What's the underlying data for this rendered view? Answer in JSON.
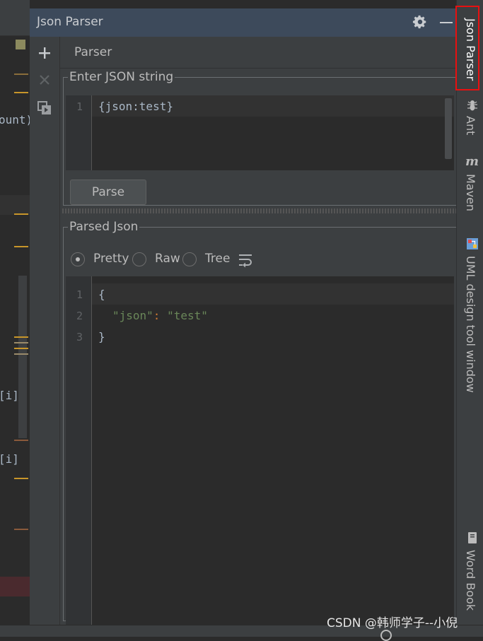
{
  "window": {
    "title": "Json Parser",
    "settings_icon": "gear-icon",
    "minimize_icon": "minimize-icon"
  },
  "toolbar": {
    "add_icon": "plus-icon",
    "close_icon": "close-icon",
    "new_window_icon": "new-window-icon"
  },
  "tab": {
    "label": "Parser"
  },
  "input_section": {
    "legend": "Enter JSON string",
    "line_numbers": [
      "1"
    ],
    "lines": [
      "{json:test}"
    ],
    "parse_button": "Parse"
  },
  "output_section": {
    "legend": "Parsed Json",
    "view_modes": [
      {
        "label": "Pretty",
        "selected": true
      },
      {
        "label": "Raw",
        "selected": false
      },
      {
        "label": "Tree",
        "selected": false
      }
    ],
    "wrap_icon": "soft-wrap-icon",
    "line_numbers": [
      "1",
      "2",
      "3"
    ],
    "lines": {
      "l1": "{",
      "l2_key": "\"json\"",
      "l2_colon": ": ",
      "l2_value": "\"test\"",
      "l3": "}"
    }
  },
  "right_stripe": {
    "items": [
      {
        "label": "Json Parser",
        "icon": "",
        "active": true
      },
      {
        "label": "Ant",
        "icon": "ant-icon",
        "active": false
      },
      {
        "label": "Maven",
        "icon": "maven-icon",
        "active": false
      },
      {
        "label": "UML design tool window",
        "icon": "uml-icon",
        "active": false
      },
      {
        "label": "Word Book",
        "icon": "book-icon",
        "active": false
      }
    ]
  },
  "editor_fragments": {
    "f1": "ount)",
    "f2": "[i]",
    "f3": "[i]"
  },
  "watermark": "CSDN @韩师学子--小倪",
  "colors": {
    "json_key": "#6a8759",
    "json_value": "#6a8759",
    "highlight_border": "#e81010",
    "title_bar": "#3d4a5b"
  }
}
